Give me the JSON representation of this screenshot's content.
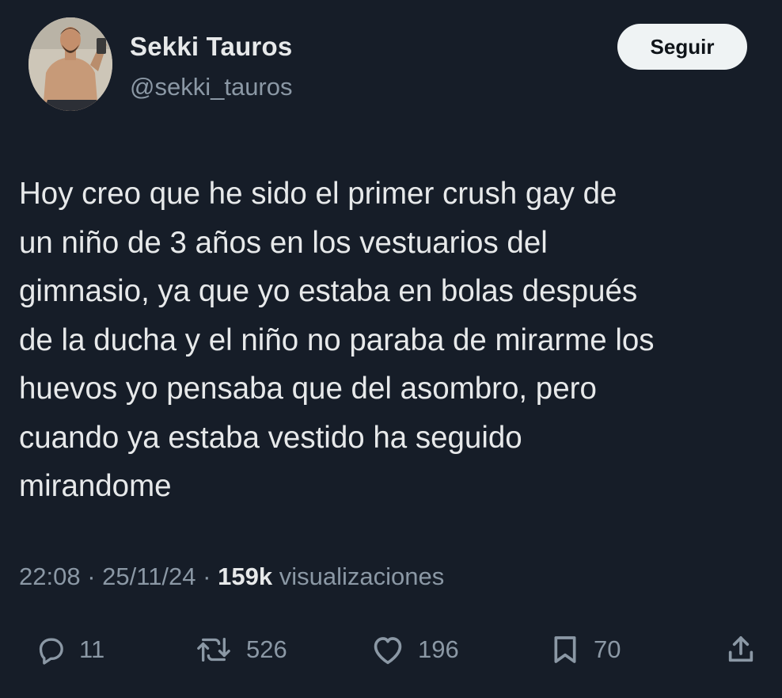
{
  "author": {
    "display_name": "Sekki Tauros",
    "handle": "@sekki_tauros",
    "avatar_icon": "profile-photo"
  },
  "follow_button": {
    "label": "Seguir"
  },
  "tweet": {
    "text": "Hoy creo que he sido el primer crush gay de\nun niño de 3 años en los vestuarios del\ngimnasio, ya que yo estaba en bolas después\nde la ducha y el niño no paraba de mirarme los\nhuevos yo pensaba que del asombro, pero\ncuando ya estaba vestido ha seguido\nmirandome",
    "time": "22:08",
    "date": "25/11/24",
    "separator": "·",
    "views_count": "159k",
    "views_label": "visualizaciones"
  },
  "actions": {
    "replies": {
      "icon": "reply-icon",
      "count": "11"
    },
    "reposts": {
      "icon": "repost-icon",
      "count": "526"
    },
    "likes": {
      "icon": "heart-icon",
      "count": "196"
    },
    "bookmarks": {
      "icon": "bookmark-icon",
      "count": "70"
    },
    "share": {
      "icon": "share-icon"
    }
  },
  "colors": {
    "background": "#161d28",
    "primary_text": "#e7e9ea",
    "secondary_text": "#8b98a5",
    "button_bg": "#eff3f4"
  }
}
